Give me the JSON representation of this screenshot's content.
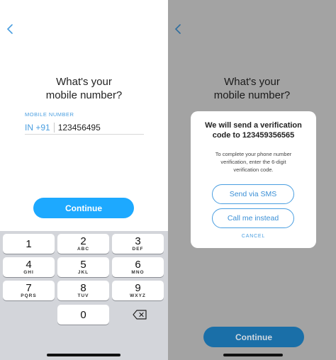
{
  "left": {
    "title_line1": "What's your",
    "title_line2": "mobile number?",
    "field_label": "MOBILE NUMBER",
    "country_code": "IN +91",
    "phone_number": "123456495",
    "continue_label": "Continue",
    "keypad": [
      {
        "digit": "1",
        "letters": ""
      },
      {
        "digit": "2",
        "letters": "ABC"
      },
      {
        "digit": "3",
        "letters": "DEF"
      },
      {
        "digit": "4",
        "letters": "GHI"
      },
      {
        "digit": "5",
        "letters": "JKL"
      },
      {
        "digit": "6",
        "letters": "MNO"
      },
      {
        "digit": "7",
        "letters": "PQRS"
      },
      {
        "digit": "8",
        "letters": "TUV"
      },
      {
        "digit": "9",
        "letters": "WXYZ"
      },
      {
        "digit": "0",
        "letters": ""
      }
    ]
  },
  "right": {
    "title_line1": "What's your",
    "title_line2": "mobile number?",
    "dialog": {
      "title_line1": "We will send a verification",
      "title_line2": "code to 123459356565",
      "body_line1": "To complete your phone number",
      "body_line2": "verification, enter the 6-digit",
      "body_line3": "verification code.",
      "sms_label": "Send via SMS",
      "call_label": "Call me instead",
      "cancel_label": "CANCEL"
    },
    "continue_label": "Continue"
  },
  "colors": {
    "accent": "#1da9ff",
    "link": "#4a9ee0",
    "overlay": "#a3a3a3"
  }
}
